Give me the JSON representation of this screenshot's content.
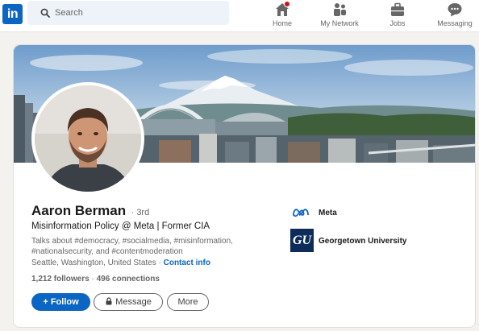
{
  "nav": {
    "logo_text": "in",
    "search_placeholder": "Search",
    "items": [
      {
        "label": "Home",
        "icon": "home-icon"
      },
      {
        "label": "My Network",
        "icon": "people-icon"
      },
      {
        "label": "Jobs",
        "icon": "briefcase-icon"
      },
      {
        "label": "Messaging",
        "icon": "chat-icon"
      }
    ]
  },
  "profile": {
    "name": "Aaron Berman",
    "degree": "· 3rd",
    "headline": "Misinformation Policy @ Meta | Former CIA",
    "about_line1": "Talks about #democracy, #socialmedia, #misinformation,",
    "about_line2": "#nationalsecurity, and #contentmoderation",
    "location": "Seattle, Washington, United States",
    "separator": " · ",
    "contact_label": "Contact info",
    "followers": "1,212 followers",
    "stats_separator": " · ",
    "connections": "496 connections"
  },
  "actions": {
    "follow_label": "+ Follow",
    "message_label": "Message",
    "more_label": "More"
  },
  "orgs": {
    "company": "Meta",
    "school": "Georgetown University",
    "school_logo_text": "GU"
  },
  "colors": {
    "brand": "#0a66c2",
    "notification": "#cc1016",
    "georgetown": "#0e2c5a"
  }
}
